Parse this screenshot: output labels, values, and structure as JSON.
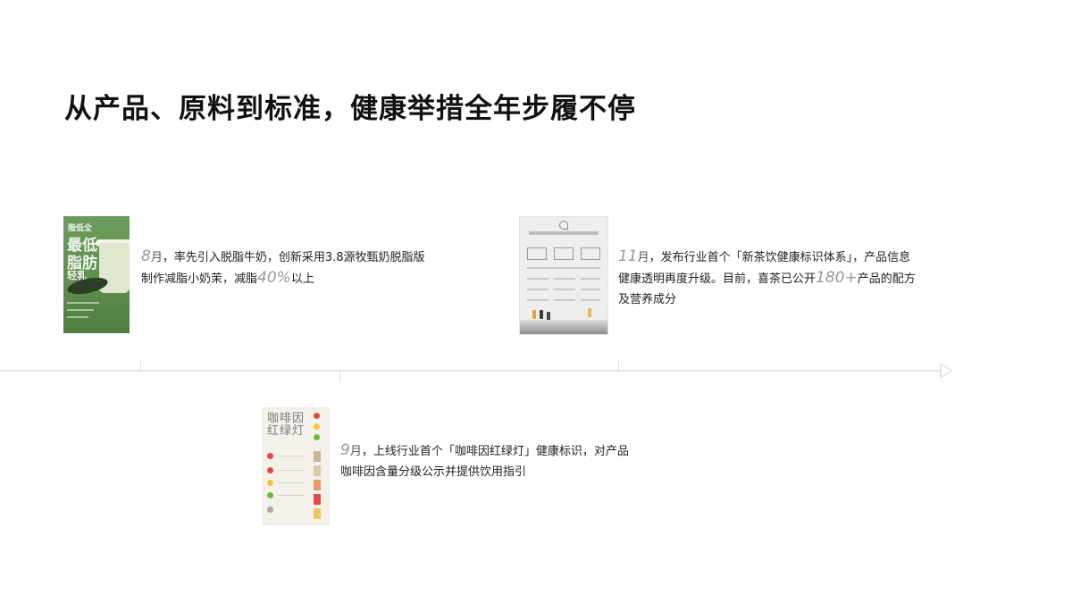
{
  "page": {
    "title": "从产品、原料到标准，健康举措全年步履不停"
  },
  "events": [
    {
      "month_num": "8",
      "month_unit": "月",
      "line1": "，率先引入脱脂牛奶，创新采用3.8源牧甄奶脱脂版",
      "line2_pre": "制作减脂小奶茉，减脂",
      "highlight": "40%",
      "line2_post": "以上",
      "poster": {
        "t1": "脂低全",
        "t2": "最低",
        "t3": "脂肪",
        "t4": "轻乳",
        "accent": "#6c9b5a"
      }
    },
    {
      "month_num": "9",
      "month_unit": "月",
      "line1": "，上线行业首个「咖啡因红绿灯」健康标识，对产品",
      "line2": "咖啡因含量分级公示并提供饮用指引",
      "poster": {
        "t1": "咖啡因",
        "t2": "红绿灯"
      }
    },
    {
      "month_num": "11",
      "month_unit": "月",
      "line1": "，发布行业首个「新茶饮健康标识体系」，产品信息",
      "line2_pre": "健康透明再度升级。目前，喜茶已公开",
      "highlight": "180+",
      "line2_post": "产品的配方",
      "line3": "及营养成分"
    }
  ],
  "colors": {
    "timeline": "#e4e4e4",
    "traffic_red": "#e04a3c",
    "traffic_yellow": "#f0c53a",
    "traffic_green": "#6cbc3c"
  }
}
